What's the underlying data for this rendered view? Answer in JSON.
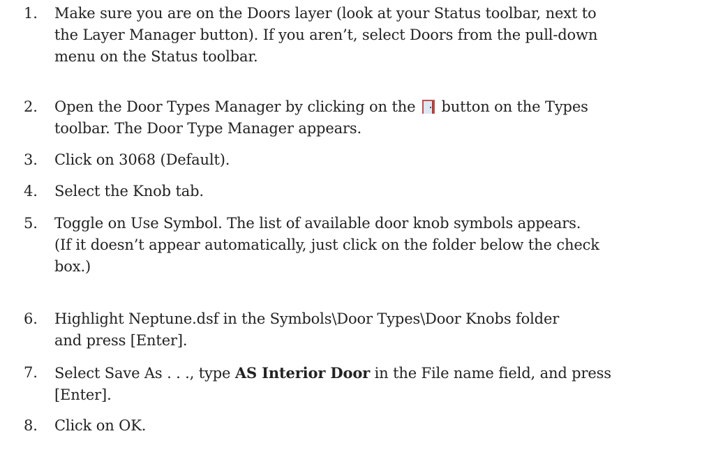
{
  "steps": [
    {
      "number": "1.",
      "lines": [
        "Make sure you are on the Doors layer (look at your Status toolbar, next to",
        "the Layer Manager button). If you aren’t, select Doors from the pull-down",
        "menu on the Status toolbar."
      ]
    },
    {
      "number": "2.",
      "line1_before_icon": "Open the Door Types Manager by clicking on the",
      "line1_after_icon": "button on the Types",
      "line2": "toolbar. The Door Type Manager appears.",
      "icon": "door-types-icon"
    },
    {
      "number": "3.",
      "lines": [
        "Click on 3068 (Default)."
      ]
    },
    {
      "number": "4.",
      "lines": [
        "Select the Knob tab."
      ]
    },
    {
      "number": "5.",
      "lines": [
        "Toggle on Use Symbol. The list of available door knob symbols appears.",
        "(If it doesn’t appear automatically, just click on the folder below the check",
        "box.)"
      ]
    },
    {
      "number": "6.",
      "lines": [
        "Highlight Neptune.dsf in the Symbols\\Door Types\\Door Knobs folder",
        "and press [Enter]."
      ]
    },
    {
      "number": "7.",
      "line1_before_bold": "Select Save As . . ., type ",
      "line1_bold": "AS Interior Door",
      "line1_after_bold": " in the File name field, and press",
      "line2": "[Enter]."
    },
    {
      "number": "8.",
      "lines": [
        "Click on OK."
      ]
    }
  ],
  "colors": {
    "text": "#222222",
    "icon_frame": "#c0504d",
    "icon_fill": "#dce8f4"
  }
}
